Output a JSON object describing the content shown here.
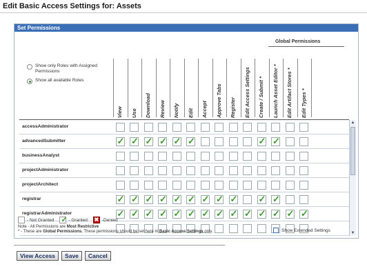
{
  "page": {
    "title": "Edit Basic Access Settings for: Assets"
  },
  "panel": {
    "header": "Set Permissions",
    "global_permissions_title": "Global Permissions"
  },
  "filter": {
    "option_assigned": "Show only Roles with Assigned Permissions",
    "option_all": "Show all available Roles",
    "selected": "option_all"
  },
  "columns": [
    "View",
    "Use",
    "Download",
    "Review",
    "Notify",
    "Edit",
    "Accept",
    "Approve Tabs",
    "Register",
    "Edit Access Settings",
    "Create / Submit *",
    "Launch Asset Editor *",
    "Edit Artifact Stores *",
    "Edit Types *"
  ],
  "rows": [
    {
      "role": "accessAdministrator",
      "perms": [
        0,
        0,
        0,
        0,
        0,
        0,
        0,
        0,
        0,
        0,
        0,
        0,
        0,
        0
      ]
    },
    {
      "role": "advancedSubmitter",
      "perms": [
        1,
        1,
        1,
        1,
        1,
        1,
        0,
        0,
        0,
        0,
        1,
        1,
        0,
        0
      ]
    },
    {
      "role": "businessAnalyst",
      "perms": [
        0,
        0,
        0,
        0,
        0,
        0,
        0,
        0,
        0,
        0,
        0,
        0,
        0,
        0
      ]
    },
    {
      "role": "projectAdministrator",
      "perms": [
        0,
        0,
        0,
        0,
        0,
        0,
        0,
        0,
        0,
        0,
        0,
        0,
        0,
        0
      ]
    },
    {
      "role": "projectArchitect",
      "perms": [
        0,
        0,
        0,
        0,
        0,
        0,
        0,
        0,
        0,
        0,
        0,
        0,
        0,
        0
      ]
    },
    {
      "role": "registrar",
      "perms": [
        1,
        1,
        1,
        1,
        1,
        1,
        1,
        1,
        1,
        0,
        1,
        1,
        0,
        0
      ]
    },
    {
      "role": "registrarAdministrator",
      "perms": [
        1,
        1,
        1,
        1,
        1,
        1,
        1,
        1,
        1,
        1,
        1,
        1,
        1,
        1
      ]
    },
    {
      "role": "",
      "perms": [
        0,
        0,
        0,
        0,
        0,
        0,
        0,
        0,
        0,
        0,
        0,
        0,
        0,
        0
      ]
    }
  ],
  "legend": {
    "not_granted": "- Not Granted",
    "granted": "- Granted",
    "denied": "-Denied",
    "note1": "Note - All Permissions are",
    "note1_bold": "Most Restrictive",
    "note2_a": "* - These are",
    "note2_b": "Global Permissions.",
    "note2_c": "These permissions should be set here in",
    "note2_d": "Basic Access Settings",
    "note2_e": "only."
  },
  "extended": {
    "label": "Show Extended Settings"
  },
  "buttons": {
    "view_access": "View Access",
    "save": "Save",
    "cancel": "Cancel"
  },
  "colors": {
    "header_bar": "#3a6fb8",
    "granted": "#3e9a2d",
    "denied": "#c21a1a"
  }
}
